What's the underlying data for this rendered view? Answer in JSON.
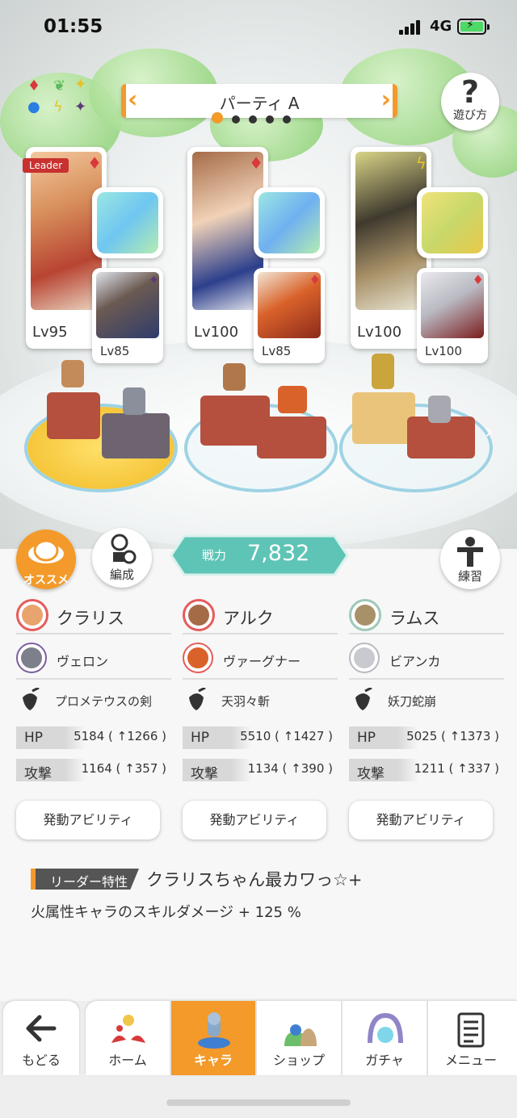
{
  "status": {
    "time": "01:55",
    "network": "4G"
  },
  "party": {
    "title": "パーティ A",
    "help_label": "遊び方",
    "leader_tag": "Leader"
  },
  "cards": [
    {
      "main_level": "Lv95",
      "sub_level": "Lv85"
    },
    {
      "main_level": "Lv100",
      "sub_level": "Lv85"
    },
    {
      "main_level": "Lv100",
      "sub_level": "Lv100"
    }
  ],
  "actions": {
    "recommend": "オススメ",
    "formation": "編成",
    "training": "練習"
  },
  "power": {
    "label": "戦力",
    "value": "7,832"
  },
  "columns": [
    {
      "main": "クラリス",
      "sub": "ヴェロン",
      "weapon": "プロメテウスの剣",
      "hp_label": "HP",
      "hp": "5184 ( ↑1266 )",
      "atk_label": "攻撃",
      "atk": "1164 ( ↑357 )",
      "ability": "発動アビリティ"
    },
    {
      "main": "アルク",
      "sub": "ヴァーグナー",
      "weapon": "天羽々斬",
      "hp_label": "HP",
      "hp": "5510 ( ↑1427 )",
      "atk_label": "攻撃",
      "atk": "1134 ( ↑390 )",
      "ability": "発動アビリティ"
    },
    {
      "main": "ラムス",
      "sub": "ビアンカ",
      "weapon": "妖刀蛇崩",
      "hp_label": "HP",
      "hp": "5025 ( ↑1373 )",
      "atk_label": "攻撃",
      "atk": "1211 ( ↑337 )",
      "ability": "発動アビリティ"
    }
  ],
  "leader_trait": {
    "tag": "リーダー特性",
    "title": "クラリスちゃん最カワっ☆+",
    "desc": "火属性キャラのスキルダメージ + 125 %"
  },
  "nav": {
    "back": "もどる",
    "home": "ホーム",
    "chara": "キャラ",
    "shop": "ショップ",
    "gacha": "ガチャ",
    "menu": "メニュー"
  },
  "colors": {
    "accent": "#f39a2a",
    "power": "#5ec4b6",
    "fire": "#e65b5b"
  }
}
